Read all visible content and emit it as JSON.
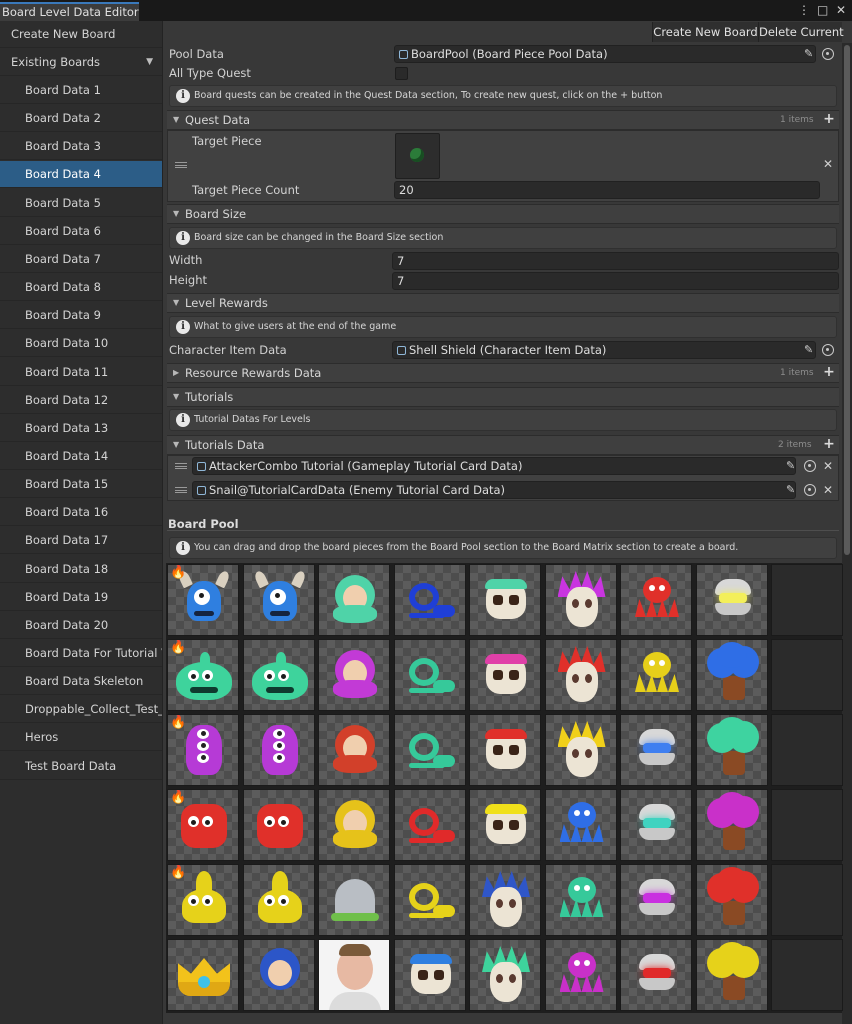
{
  "window": {
    "title": "Board Level Data Editor"
  },
  "sidebar": {
    "create_label": "Create New Board",
    "existing_label": "Existing Boards",
    "items": [
      {
        "label": "Board Data 1"
      },
      {
        "label": "Board Data 2"
      },
      {
        "label": "Board Data 3"
      },
      {
        "label": "Board Data 4"
      },
      {
        "label": "Board Data 5"
      },
      {
        "label": "Board Data 6"
      },
      {
        "label": "Board Data 7"
      },
      {
        "label": "Board Data 8"
      },
      {
        "label": "Board Data 9"
      },
      {
        "label": "Board Data 10"
      },
      {
        "label": "Board Data 11"
      },
      {
        "label": "Board Data 12"
      },
      {
        "label": "Board Data 13"
      },
      {
        "label": "Board Data 14"
      },
      {
        "label": "Board Data 15"
      },
      {
        "label": "Board Data 16"
      },
      {
        "label": "Board Data 17"
      },
      {
        "label": "Board Data 18"
      },
      {
        "label": "Board Data 19"
      },
      {
        "label": "Board Data 20"
      },
      {
        "label": "Board Data For Tutorial Vi"
      },
      {
        "label": "Board Data Skeleton"
      },
      {
        "label": "Droppable_Collect_Test_B"
      },
      {
        "label": "Heros"
      },
      {
        "label": "Test Board Data"
      }
    ],
    "selected": "Board Data 4"
  },
  "toolbar": {
    "create_label": "Create New Board",
    "delete_label": "Delete Current"
  },
  "inspector": {
    "pool_data_label": "Pool Data",
    "pool_data_value": "BoardPool (Board Piece Pool Data)",
    "all_type_quest_label": "All Type Quest",
    "quest_info": "Board quests can be created in the Quest Data section, To create new quest, click on the + button",
    "quest_data_label": "Quest Data",
    "quest_items_count": "1 items",
    "target_piece_label": "Target Piece",
    "target_piece_count_label": "Target Piece Count",
    "target_piece_count_value": "20",
    "board_size_label": "Board Size",
    "board_size_info": "Board size can be changed in the Board Size section",
    "width_label": "Width",
    "width_value": "7",
    "height_label": "Height",
    "height_value": "7",
    "level_rewards_label": "Level Rewards",
    "level_rewards_info": "What to give users at the end of the game",
    "character_item_label": "Character Item Data",
    "character_item_value": "Shell Shield (Character Item Data)",
    "resource_rewards_label": "Resource Rewards Data",
    "resource_items_count": "1 items",
    "tutorials_label": "Tutorials",
    "tutorials_info": "Tutorial Datas For Levels",
    "tutorials_data_label": "Tutorials Data",
    "tutorials_items_count": "2 items",
    "tutorial_items": [
      {
        "value": "AttackerCombo Tutorial (Gameplay Tutorial Card Data)"
      },
      {
        "value": "Snail@TutorialCardData (Enemy Tutorial Card Data)"
      }
    ]
  },
  "board_pool": {
    "title": "Board Pool",
    "info": "You can drag and drop the board pieces from the Board Pool section to the Board Matrix section to create a board."
  },
  "colors": {
    "accent": "#2c5d87",
    "background": "#383838",
    "sidebar": "#2d2d2d"
  }
}
